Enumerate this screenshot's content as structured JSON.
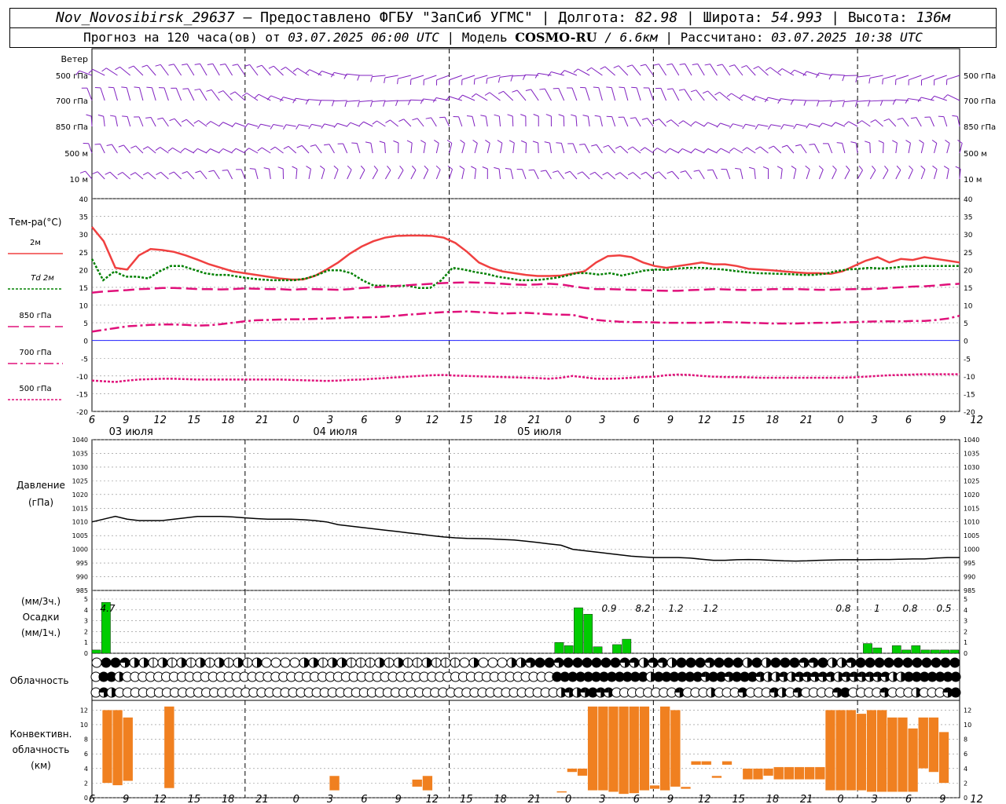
{
  "header": {
    "station": "Nov_Novosibirsk_29637",
    "provider": "– Предоставлено ФГБУ \"ЗапСиб УГМС\"",
    "lon_label": "Долгота:",
    "lon": "82.98",
    "lat_label": "Широта:",
    "lat": "54.993",
    "alt_label": "Высота:",
    "alt": "136м",
    "forecast_label": "Прогноз на 120 часа(ов) от",
    "forecast_time": "03.07.2025 06:00 UTC",
    "model_label": "| Модель",
    "model": "COSMO-RU",
    "model_res": "/ 6.6км",
    "calc_label": "| Рассчитано:",
    "calc_time": "03.07.2025 10:38 UTC"
  },
  "chart_data": {
    "type": "line",
    "x_hour_ticks": [
      "6",
      "9",
      "12",
      "15",
      "18",
      "21",
      "0",
      "3",
      "6",
      "9",
      "12",
      "15",
      "18",
      "21",
      "0",
      "3",
      "6",
      "9",
      "12",
      "15",
      "18",
      "21",
      "0",
      "3",
      "6",
      "9",
      "12"
    ],
    "date_labels": [
      "03 июля",
      "04 июля",
      "05 июля"
    ],
    "wind": {
      "title": "Ветер",
      "levels": [
        "500 гПа",
        "700 гПа",
        "850 гПа",
        "500 м",
        "10 м"
      ]
    },
    "temperature": {
      "title": "Тем-ра(°C)",
      "ylim": [
        -20,
        40
      ],
      "ticks": [
        "40",
        "35",
        "30",
        "25",
        "20",
        "15",
        "10",
        "5",
        "0",
        "-5",
        "-10",
        "-15",
        "-20"
      ],
      "series": [
        {
          "name": "2м",
          "color": "#f04040",
          "style": "solid",
          "values": [
            32,
            28,
            20.5,
            20,
            24,
            25.8,
            25.5,
            25,
            24,
            22.8,
            21.5,
            20.5,
            19.5,
            19,
            18.5,
            18,
            17.5,
            17.2,
            17.2,
            18.2,
            20,
            22,
            24.5,
            26.5,
            28,
            29,
            29.5,
            29.6,
            29.6,
            29.5,
            29,
            27.5,
            25,
            22,
            20.5,
            19.5,
            19,
            18.5,
            18.2,
            18.2,
            18.3,
            18.9,
            19.5,
            22,
            23.8,
            24,
            23.5,
            22,
            21,
            20.5,
            21,
            21.5,
            22,
            21.5,
            21.5,
            21,
            20.2,
            20,
            19.8,
            19.5,
            19.2,
            19,
            19,
            18.8,
            19.5,
            21,
            22.5,
            23.5,
            22,
            23,
            22.7,
            23.5,
            23,
            22.5,
            22
          ]
        },
        {
          "name": "Td 2м",
          "color": "#008000",
          "style": "dot",
          "values": [
            23,
            17,
            19.5,
            18,
            18,
            17.5,
            19.5,
            21,
            21,
            20,
            19,
            18.5,
            18.5,
            18,
            17.5,
            17.2,
            17,
            17,
            17,
            17.5,
            18.5,
            19.8,
            19.8,
            19,
            17,
            15.5,
            15.5,
            15.3,
            15.5,
            14.8,
            14.8,
            17,
            20.5,
            20,
            19.3,
            18.8,
            18,
            17.5,
            17,
            17,
            17.2,
            17.6,
            18.2,
            19,
            19,
            18.6,
            19,
            18.3,
            19,
            19.7,
            20,
            19.9,
            20.3,
            20.5,
            20.5,
            20.3,
            20,
            19.6,
            19.3,
            19,
            18.9,
            18.8,
            18.7,
            18.5,
            18.5,
            18.8,
            19.5,
            20,
            20.2,
            20.5,
            20.3,
            20.5,
            20.8,
            21,
            21,
            21,
            21,
            21
          ]
        },
        {
          "name": "850 гПа",
          "color": "#e0107a",
          "style": "dash",
          "values": [
            13.5,
            13.8,
            14,
            14.2,
            14.5,
            14.6,
            14.8,
            14.8,
            14.7,
            14.5,
            14.5,
            14.4,
            14.5,
            14.7,
            14.6,
            14.5,
            14.5,
            14.3,
            14.5,
            14.5,
            14.4,
            14.3,
            14.5,
            14.8,
            15,
            15.2,
            15.4,
            15.6,
            15.8,
            16,
            16.2,
            16.3,
            16.4,
            16.3,
            16.2,
            16,
            15.8,
            15.7,
            15.8,
            16,
            15.8,
            15.3,
            14.8,
            14.5,
            14.5,
            14.4,
            14.3,
            14.2,
            14.1,
            14,
            14,
            14.2,
            14.3,
            14.5,
            14.4,
            14.3,
            14.2,
            14.3,
            14.5,
            14.5,
            14.5,
            14.4,
            14.3,
            14.3,
            14.4,
            14.5,
            14.5,
            14.6,
            14.8,
            15,
            15.2,
            15.3,
            15.5,
            15.8,
            16
          ]
        },
        {
          "name": "700 гПа",
          "color": "#e0107a",
          "style": "dashdot",
          "values": [
            2.5,
            3,
            3.5,
            4,
            4.2,
            4.4,
            4.5,
            4.5,
            4.4,
            4.2,
            4.3,
            4.6,
            5,
            5.4,
            5.7,
            5.8,
            5.9,
            6,
            6,
            6.1,
            6.2,
            6.3,
            6.5,
            6.5,
            6.6,
            6.7,
            7,
            7.3,
            7.5,
            7.8,
            8,
            8.1,
            8.2,
            8,
            7.8,
            7.6,
            7.7,
            7.8,
            7.6,
            7.4,
            7.3,
            7.2,
            6.5,
            5.8,
            5.5,
            5.3,
            5.2,
            5.2,
            5.1,
            5,
            5,
            5,
            5,
            5.1,
            5.2,
            5.1,
            5,
            4.9,
            4.8,
            4.8,
            4.8,
            4.9,
            5,
            5,
            5.1,
            5.2,
            5.3,
            5.4,
            5.4,
            5.4,
            5.5,
            5.5,
            5.8,
            6.2,
            7
          ]
        },
        {
          "name": "500 гПа",
          "color": "#e0107a",
          "style": "dot",
          "values": [
            -11.3,
            -11.5,
            -11.7,
            -11.3,
            -11,
            -10.9,
            -10.8,
            -10.8,
            -10.9,
            -11,
            -11,
            -11,
            -11,
            -11,
            -11,
            -11,
            -11,
            -11.1,
            -11.2,
            -11.3,
            -11.4,
            -11.3,
            -11.1,
            -11,
            -10.8,
            -10.6,
            -10.4,
            -10.2,
            -10,
            -9.8,
            -9.7,
            -9.9,
            -10,
            -10.1,
            -10.2,
            -10.3,
            -10.4,
            -10.5,
            -10.6,
            -10.8,
            -10.5,
            -10,
            -10.4,
            -10.8,
            -10.8,
            -10.7,
            -10.5,
            -10.3,
            -10.2,
            -9.8,
            -9.6,
            -9.7,
            -10,
            -10.2,
            -10.3,
            -10.3,
            -10.4,
            -10.5,
            -10.5,
            -10.5,
            -10.5,
            -10.5,
            -10.5,
            -10.5,
            -10.5,
            -10.4,
            -10.2,
            -10,
            -9.8,
            -9.7,
            -9.6,
            -9.5,
            -9.5,
            -9.5,
            -9.5
          ]
        }
      ]
    },
    "pressure": {
      "title": "Давление",
      "unit": "(гПа)",
      "ylim": [
        985,
        1040
      ],
      "ticks": [
        "1040",
        "1035",
        "1030",
        "1025",
        "1020",
        "1015",
        "1010",
        "1005",
        "1000",
        "995",
        "990",
        "985"
      ],
      "values": [
        1010,
        1011,
        1012,
        1011,
        1010.5,
        1010.5,
        1010.5,
        1011,
        1011.5,
        1012,
        1012,
        1012,
        1011.8,
        1011.5,
        1011.2,
        1011,
        1011,
        1011,
        1010.8,
        1010.5,
        1010,
        1009,
        1008.5,
        1008,
        1007.5,
        1007,
        1006.5,
        1006,
        1005.5,
        1005,
        1004.5,
        1004.2,
        1004,
        1003.9,
        1003.8,
        1003.6,
        1003.4,
        1003,
        1002.5,
        1002,
        1001.5,
        1000,
        999.5,
        999,
        998.5,
        998,
        997.5,
        997.2,
        997,
        997,
        997,
        996.8,
        996.4,
        996,
        996,
        996.2,
        996.3,
        996.2,
        996,
        995.8,
        995.7,
        995.8,
        996,
        996.1,
        996.2,
        996.2,
        996.2,
        996.3,
        996.3,
        996.4,
        996.5,
        996.5,
        996.8,
        997,
        997
      ]
    },
    "precip": {
      "title": "Осадки",
      "unit3": "(мм/3ч.)",
      "unit1": "(мм/1ч.)",
      "ylim": [
        0,
        5
      ],
      "ticks": [
        "5",
        "4",
        "3",
        "2",
        "1",
        "0"
      ],
      "labels": [
        "4.7",
        "0.9",
        "8.2",
        "1.2",
        "1.2",
        "0.8",
        "1",
        "0.8",
        "0.5"
      ],
      "bars": [
        0.3,
        4.7,
        0,
        0,
        0,
        0,
        0,
        0,
        0,
        0,
        0,
        0,
        0,
        0,
        0,
        0,
        0,
        0,
        0,
        0,
        0,
        0,
        0,
        0,
        0,
        0,
        0,
        0,
        0,
        0,
        0,
        0,
        0,
        0,
        0,
        0,
        0,
        0,
        0,
        0,
        0,
        0,
        0,
        0,
        0,
        0,
        0,
        0,
        1,
        0.7,
        4.2,
        3.6,
        0.6,
        0,
        0.8,
        1.3,
        0,
        0,
        0,
        0,
        0,
        0,
        0,
        0,
        0,
        0,
        0,
        0,
        0,
        0,
        0,
        0,
        0,
        0,
        0,
        0,
        0,
        0,
        0,
        0,
        0.9,
        0.5,
        0,
        0.7,
        0.3,
        0.7,
        0.3,
        0.3,
        0.3,
        0.3
      ]
    },
    "cloud": {
      "title": "Облачность",
      "rows": [
        [
          0,
          8,
          8,
          6,
          4,
          4,
          2,
          4,
          2,
          4,
          2,
          4,
          2,
          4,
          2,
          4,
          2,
          4,
          0,
          0,
          0,
          0,
          4,
          4,
          2,
          4,
          4,
          2,
          2,
          2,
          4,
          2,
          4,
          2,
          2,
          4,
          2,
          2,
          2,
          0,
          4,
          0,
          0,
          0,
          4,
          4,
          6,
          8,
          8,
          6,
          8,
          8,
          8,
          8,
          8,
          8,
          6,
          6,
          4,
          6,
          6,
          4,
          8,
          8,
          8,
          6,
          8,
          8,
          8,
          4,
          8,
          4,
          8,
          8,
          8,
          6,
          6,
          8,
          4,
          4,
          6,
          8,
          8,
          8,
          8,
          8,
          8,
          8,
          8,
          8,
          8,
          8
        ],
        [
          0,
          8,
          8,
          4,
          0,
          0,
          0,
          0,
          0,
          0,
          0,
          0,
          0,
          0,
          0,
          0,
          0,
          0,
          0,
          0,
          0,
          0,
          0,
          0,
          0,
          0,
          0,
          0,
          0,
          0,
          0,
          0,
          0,
          0,
          0,
          0,
          0,
          0,
          0,
          0,
          0,
          0,
          0,
          0,
          0,
          0,
          0,
          0,
          0,
          0,
          0,
          0,
          0,
          0,
          0,
          0,
          0,
          0,
          0,
          8,
          8,
          8,
          8,
          8,
          8,
          8,
          8,
          8,
          8,
          8,
          8,
          4,
          8,
          8,
          8,
          8,
          8,
          8,
          6,
          8,
          8,
          6,
          8,
          8,
          8,
          6,
          4,
          4,
          6,
          4,
          6,
          6,
          6,
          6,
          6,
          4,
          6,
          6,
          6,
          6,
          6,
          6,
          4,
          4,
          8,
          8,
          8,
          8,
          8,
          8,
          8
        ],
        [
          0,
          6,
          4,
          0,
          0,
          0,
          0,
          0,
          0,
          0,
          0,
          0,
          0,
          0,
          0,
          0,
          0,
          0,
          0,
          0,
          0,
          0,
          0,
          0,
          0,
          0,
          0,
          0,
          0,
          0,
          0,
          0,
          0,
          0,
          0,
          0,
          0,
          0,
          0,
          0,
          0,
          0,
          0,
          0,
          0,
          0,
          0,
          0,
          0,
          0,
          0,
          0,
          0,
          0,
          0,
          0,
          0,
          0,
          0,
          4,
          6,
          4,
          6,
          8,
          6,
          6,
          0,
          0,
          0,
          0,
          0,
          0,
          0,
          0,
          6,
          0,
          0,
          0,
          4,
          0,
          0,
          0,
          6,
          0,
          0,
          0,
          6,
          4,
          0,
          6,
          0,
          0,
          0,
          0,
          6,
          8,
          0,
          0,
          0,
          0,
          6,
          0,
          0,
          0,
          4,
          0,
          0,
          0,
          6,
          8
        ]
      ]
    },
    "convective": {
      "title": "Конвективн. облачность",
      "unit": "(км)",
      "ylim": [
        0,
        13
      ],
      "ticks": [
        "12",
        "10",
        "8",
        "6",
        "4",
        "2",
        "0"
      ],
      "bars": [
        [
          1,
          2,
          12
        ],
        [
          2,
          1.7,
          12
        ],
        [
          3,
          2.3,
          11
        ],
        [
          7,
          1.3,
          12.5
        ],
        [
          23,
          1,
          3
        ],
        [
          26,
          2.5,
          2.5
        ],
        [
          27,
          2.5,
          2.5
        ],
        [
          31,
          1.5,
          2.5
        ],
        [
          32,
          1,
          3
        ],
        [
          45,
          0.7,
          0.9
        ],
        [
          46,
          3.5,
          4
        ],
        [
          47,
          3,
          4
        ],
        [
          48,
          1,
          12.5
        ],
        [
          49,
          1,
          12.5
        ],
        [
          50,
          0.8,
          12.5
        ],
        [
          51,
          0.5,
          12.5
        ],
        [
          52,
          0.6,
          12.5
        ],
        [
          53,
          1,
          12.5
        ],
        [
          54,
          1.2,
          1.7
        ],
        [
          55,
          1,
          12.5
        ],
        [
          56,
          1.5,
          12
        ],
        [
          57,
          1.2,
          1.5
        ],
        [
          58,
          4.5,
          5
        ],
        [
          59,
          4.5,
          5
        ],
        [
          60,
          2.7,
          3
        ],
        [
          61,
          4.5,
          5
        ],
        [
          63,
          2.5,
          4
        ],
        [
          64,
          2.5,
          4
        ],
        [
          65,
          3,
          4
        ],
        [
          66,
          2.5,
          4.2
        ],
        [
          67,
          2.5,
          4.2
        ],
        [
          68,
          2.5,
          4.2
        ],
        [
          69,
          2.5,
          4.2
        ],
        [
          70,
          2.5,
          4.2
        ],
        [
          71,
          1,
          12
        ],
        [
          72,
          1,
          12
        ],
        [
          73,
          1,
          12
        ],
        [
          74,
          1,
          11.5
        ],
        [
          75,
          0.8,
          12
        ],
        [
          76,
          0.8,
          12
        ],
        [
          77,
          0.8,
          11
        ],
        [
          78,
          0.8,
          11
        ],
        [
          79,
          0.8,
          9.5
        ],
        [
          80,
          4,
          11
        ],
        [
          81,
          3.5,
          11
        ],
        [
          82,
          2,
          9
        ]
      ]
    }
  },
  "colors": {
    "wind": "#8020c0",
    "grid": "#888888",
    "precip": "#00cc00",
    "convective": "#f08020",
    "zero_line": "#2020ff"
  }
}
